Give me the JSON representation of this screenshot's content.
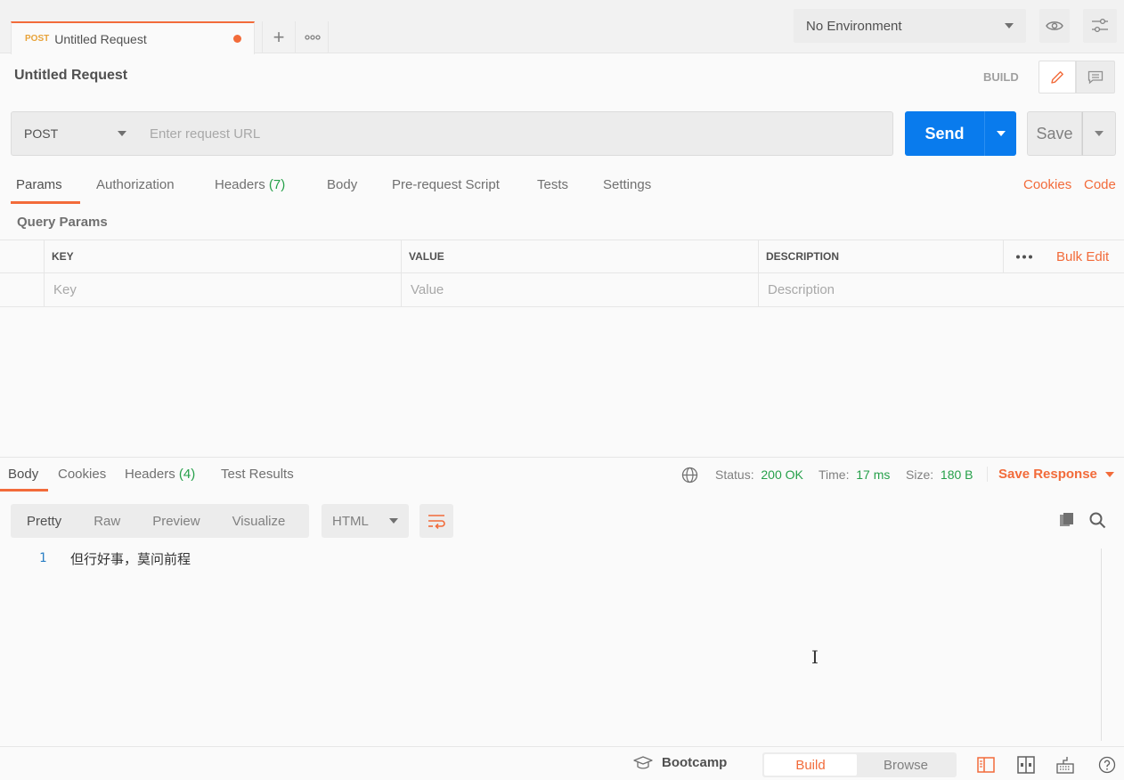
{
  "tab": {
    "method": "POST",
    "title": "Untitled Request",
    "plus": "+"
  },
  "environment": {
    "selected": "No Environment"
  },
  "request": {
    "title": "Untitled Request",
    "build_label": "BUILD",
    "method": "POST",
    "url_placeholder": "Enter request URL",
    "send_label": "Send",
    "save_label": "Save"
  },
  "request_tabs": {
    "params": "Params",
    "authorization": "Authorization",
    "headers": "Headers",
    "headers_count": "(7)",
    "body": "Body",
    "pre_request": "Pre-request Script",
    "tests": "Tests",
    "settings": "Settings",
    "cookies": "Cookies",
    "code": "Code"
  },
  "query_params": {
    "title": "Query Params",
    "columns": [
      "KEY",
      "VALUE",
      "DESCRIPTION"
    ],
    "bulk_edit": "Bulk Edit",
    "placeholders": [
      "Key",
      "Value",
      "Description"
    ]
  },
  "response_tabs": {
    "body": "Body",
    "cookies": "Cookies",
    "headers": "Headers",
    "headers_count": "(4)",
    "test_results": "Test Results"
  },
  "response_meta": {
    "status_label": "Status:",
    "status_value": "200 OK",
    "time_label": "Time:",
    "time_value": "17 ms",
    "size_label": "Size:",
    "size_value": "180 B",
    "save_response": "Save Response"
  },
  "viewer": {
    "modes": [
      "Pretty",
      "Raw",
      "Preview",
      "Visualize"
    ],
    "format": "HTML"
  },
  "response_body": {
    "line_number": "1",
    "content": "但行好事，莫问前程"
  },
  "footer": {
    "bootcamp": "Bootcamp",
    "build": "Build",
    "browse": "Browse"
  },
  "colors": {
    "accent": "#f26b3a",
    "send": "#097bed",
    "success": "#26a04a"
  },
  "icons": [
    "plus-icon",
    "more-icon",
    "eye-icon",
    "sliders-icon",
    "pencil-icon",
    "comment-icon",
    "caret-down-icon",
    "globe-icon",
    "wrap-icon",
    "copy-icon",
    "search-icon",
    "graduation-cap-icon",
    "sidebar-icon",
    "two-pane-icon",
    "keyboard-icon",
    "help-icon"
  ]
}
